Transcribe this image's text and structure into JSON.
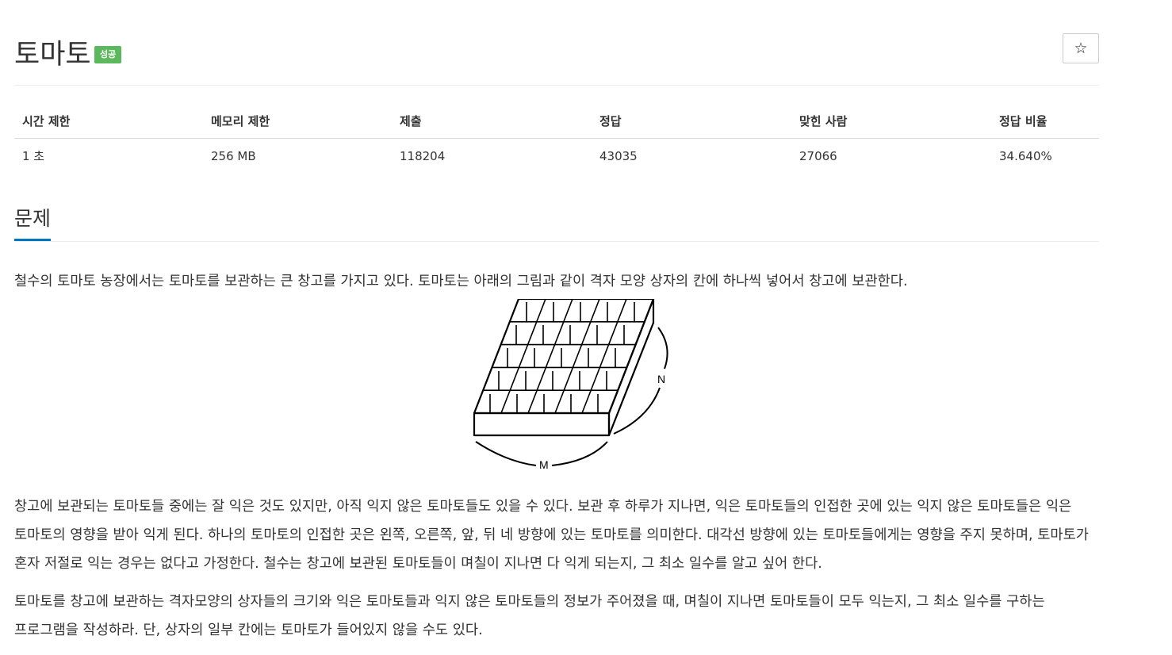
{
  "problem": {
    "title": "토마토",
    "badge": "성공",
    "star_icon": "☆"
  },
  "info_table": {
    "headers": [
      "시간 제한",
      "메모리 제한",
      "제출",
      "정답",
      "맞힌 사람",
      "정답 비율"
    ],
    "values": [
      "1 초",
      "256 MB",
      "118204",
      "43035",
      "27066",
      "34.640%"
    ]
  },
  "section": {
    "title": "문제"
  },
  "description": {
    "p1": "철수의 토마토 농장에서는 토마토를 보관하는 큰 창고를 가지고 있다. 토마토는 아래의 그림과 같이 격자 모양 상자의 칸에 하나씩 넣어서 창고에 보관한다.",
    "figure": {
      "label_n": "N",
      "label_m": "M"
    },
    "p2": "창고에 보관되는 토마토들 중에는 잘 익은 것도 있지만, 아직 익지 않은 토마토들도 있을 수 있다. 보관 후 하루가 지나면, 익은 토마토들의 인접한 곳에 있는 익지 않은 토마토들은 익은 토마토의 영향을 받아 익게 된다. 하나의 토마토의 인접한 곳은 왼쪽, 오른쪽, 앞, 뒤 네 방향에 있는 토마토를 의미한다. 대각선 방향에 있는 토마토들에게는 영향을 주지 못하며, 토마토가 혼자 저절로 익는 경우는 없다고 가정한다. 철수는 창고에 보관된 토마토들이 며칠이 지나면 다 익게 되는지, 그 최소 일수를 알고 싶어 한다.",
    "p3": "토마토를 창고에 보관하는 격자모양의 상자들의 크기와 익은 토마토들과 익지 않은 토마토들의 정보가 주어졌을 때, 며칠이 지나면 토마토들이 모두 익는지, 그 최소 일수를 구하는 프로그램을 작성하라. 단, 상자의 일부 칸에는 토마토가 들어있지 않을 수도 있다."
  }
}
